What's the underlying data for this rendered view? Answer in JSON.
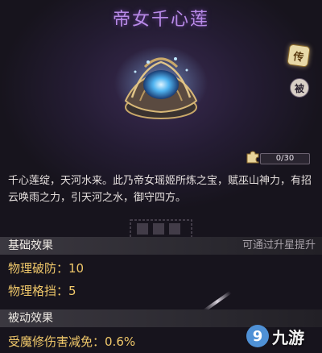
{
  "item": {
    "name": "帝女千心莲",
    "rarity_badge": "传",
    "passive_badge": "被",
    "fragments": {
      "text": "0/30",
      "current": 0,
      "total": 30
    },
    "description": "千心莲绽，天河水来。此乃帝女瑶姬所炼之宝，赋巫山神力，有招云唤雨之力，引天河之水，御守四方。"
  },
  "basic_effects": {
    "header": "基础效果",
    "upgrade_hint": "可通过升星提升",
    "stats": [
      {
        "label": "物理破防：",
        "value": "10"
      },
      {
        "label": "物理格挡：",
        "value": "5"
      }
    ]
  },
  "passive_effects": {
    "header": "被动效果",
    "stats": [
      {
        "label": "受魔修伤害减免：",
        "value": "0.6%"
      }
    ]
  },
  "watermark": {
    "logo_glyph": "9",
    "text": "九游"
  },
  "colors": {
    "title": "#b98ae8",
    "stat_text": "#f0c86a",
    "panel_bg": "#241c33"
  }
}
